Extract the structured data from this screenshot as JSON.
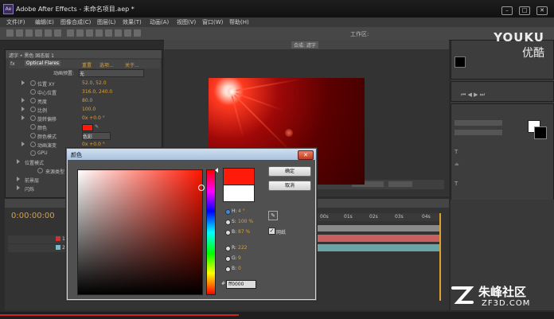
{
  "window": {
    "title": "Adobe After Effects - 未命名项目.aep *",
    "app_icon": "after-effects-logo",
    "buttons": [
      "minimize",
      "maximize",
      "close"
    ]
  },
  "menu": [
    "文件(F)",
    "编辑(E)",
    "图像合成(C)",
    "图层(L)",
    "效果(T)",
    "动画(A)",
    "视图(V)",
    "窗口(W)",
    "帮助(H)"
  ],
  "toolbar": {
    "workspace_label": "工作区:"
  },
  "effects_panel": {
    "header": "滤字 • 黑色 固态层 1",
    "effect_name": "Optical Flares",
    "links": [
      "重置",
      "选项...",
      "关于..."
    ],
    "preset_label": "动画预置:",
    "preset_value": "无",
    "properties": [
      {
        "label": "位置 XY",
        "value": "52.0, 52.0"
      },
      {
        "label": "中心位置",
        "value": "316.0, 240.0"
      },
      {
        "label": "亮度",
        "value": "80.0"
      },
      {
        "label": "比例",
        "value": "100.0"
      },
      {
        "label": "旋转偏移",
        "value": "0x +0.0 °"
      },
      {
        "label": "颜色",
        "value": ""
      },
      {
        "label": "颜色模式",
        "value": "色彩"
      },
      {
        "label": "动画演变",
        "value": "0x +0.0 °"
      },
      {
        "label": "GPU",
        "value": ""
      },
      {
        "label": "位置模式",
        "value": ""
      },
      {
        "label": "来源类型",
        "value": ""
      },
      {
        "label": "前景层",
        "value": ""
      },
      {
        "label": "闪烁",
        "value": ""
      }
    ]
  },
  "comp_panel": {
    "tab": "合成: 滤字"
  },
  "timeline": {
    "timecode": "0:00:00:00",
    "ruler_ticks": [
      "00s",
      "01s",
      "02s",
      "03s",
      "04s"
    ],
    "layers": [
      "1",
      "2"
    ]
  },
  "color_dialog": {
    "title": "颜色",
    "ok_label": "确定",
    "cancel_label": "取消",
    "fields": [
      {
        "label": "H:",
        "value": "4 °"
      },
      {
        "label": "S:",
        "value": "100 %"
      },
      {
        "label": "B:",
        "value": "87 %"
      },
      {
        "label": "R:",
        "value": "222"
      },
      {
        "label": "G:",
        "value": "9"
      },
      {
        "label": "B:",
        "value": "0"
      }
    ],
    "only_web_colors_label": "网纸",
    "hex_value": "ff0000",
    "new_color": "#ff1a0a",
    "old_color": "#ffffff"
  },
  "watermarks": {
    "youku_en": "YOUKU",
    "youku_cn": "优酷",
    "zf_cn": "朱峰社区",
    "zf_url": "ZF3D.COM"
  }
}
